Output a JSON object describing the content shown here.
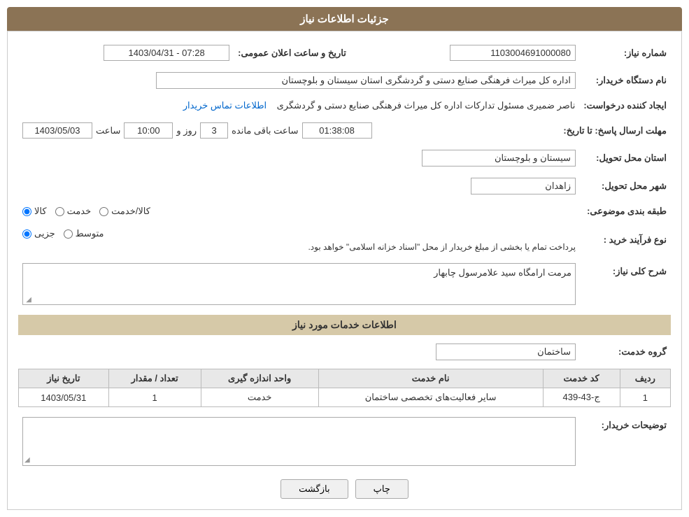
{
  "page": {
    "title": "جزئیات اطلاعات نیاز",
    "fields": {
      "shomara_niaz_label": "شماره نیاز:",
      "shomara_niaz_value": "1103004691000080",
      "nam_dastgah_label": "نام دستگاه خریدار:",
      "nam_dastgah_value": "اداره کل میراث فرهنگی  صنایع دستی و گردشگری استان سیستان و بلوچستان",
      "creator_label": "ایجاد کننده درخواست:",
      "creator_value": "ناصر ضمیری مسئول تدارکات اداره کل میراث فرهنگی  صنایع دستی و گردشگری",
      "contact_link": "اطلاعات تماس خریدار",
      "mohlat_label": "مهلت ارسال پاسخ: تا تاریخ:",
      "date_value": "1403/05/03",
      "saat_label": "ساعت",
      "saat_value": "10:00",
      "roz_label": "روز و",
      "roz_value": "3",
      "remaining_value": "01:38:08",
      "remaining_label": "ساعت باقی مانده",
      "ostan_label": "استان محل تحویل:",
      "ostan_value": "سیستان و بلوچستان",
      "shahr_label": "شهر محل تحویل:",
      "shahr_value": "زاهدان",
      "tabaghebandi_label": "طبقه بندی موضوعی:",
      "radio_kala": "کالا",
      "radio_khadamat": "خدمت",
      "radio_kala_khadamat": "کالا/خدمت",
      "noefr_label": "نوع فرآیند خرید :",
      "radio_jozi": "جزیی",
      "radio_motevaset": "متوسط",
      "purchase_note": "پرداخت تمام یا بخشی از مبلغ خریدار از محل \"اسناد خزانه اسلامی\" خواهد بود.",
      "sharh_label": "شرح کلی نیاز:",
      "sharh_value": "مرمت ارامگاه سید علامرسول چابهار",
      "services_section_title": "اطلاعات خدمات مورد نیاز",
      "grooh_khadamat_label": "گروه خدمت:",
      "grooh_khadamat_value": "ساختمان",
      "table": {
        "headers": [
          "ردیف",
          "کد خدمت",
          "نام خدمت",
          "واحد اندازه گیری",
          "تعداد / مقدار",
          "تاریخ نیاز"
        ],
        "rows": [
          {
            "radif": "1",
            "kod": "ج-43-439",
            "name": "سایر فعالیت‌های تخصصی ساختمان",
            "vahed": "خدمت",
            "tedad": "1",
            "tarikh": "1403/05/31"
          }
        ]
      },
      "buyer_desc_label": "توضیحات خریدار:",
      "btn_chap": "چاپ",
      "btn_bazgasht": "بازگشت",
      "taarikh_alan": "1403/04/31 - 07:28"
    }
  }
}
